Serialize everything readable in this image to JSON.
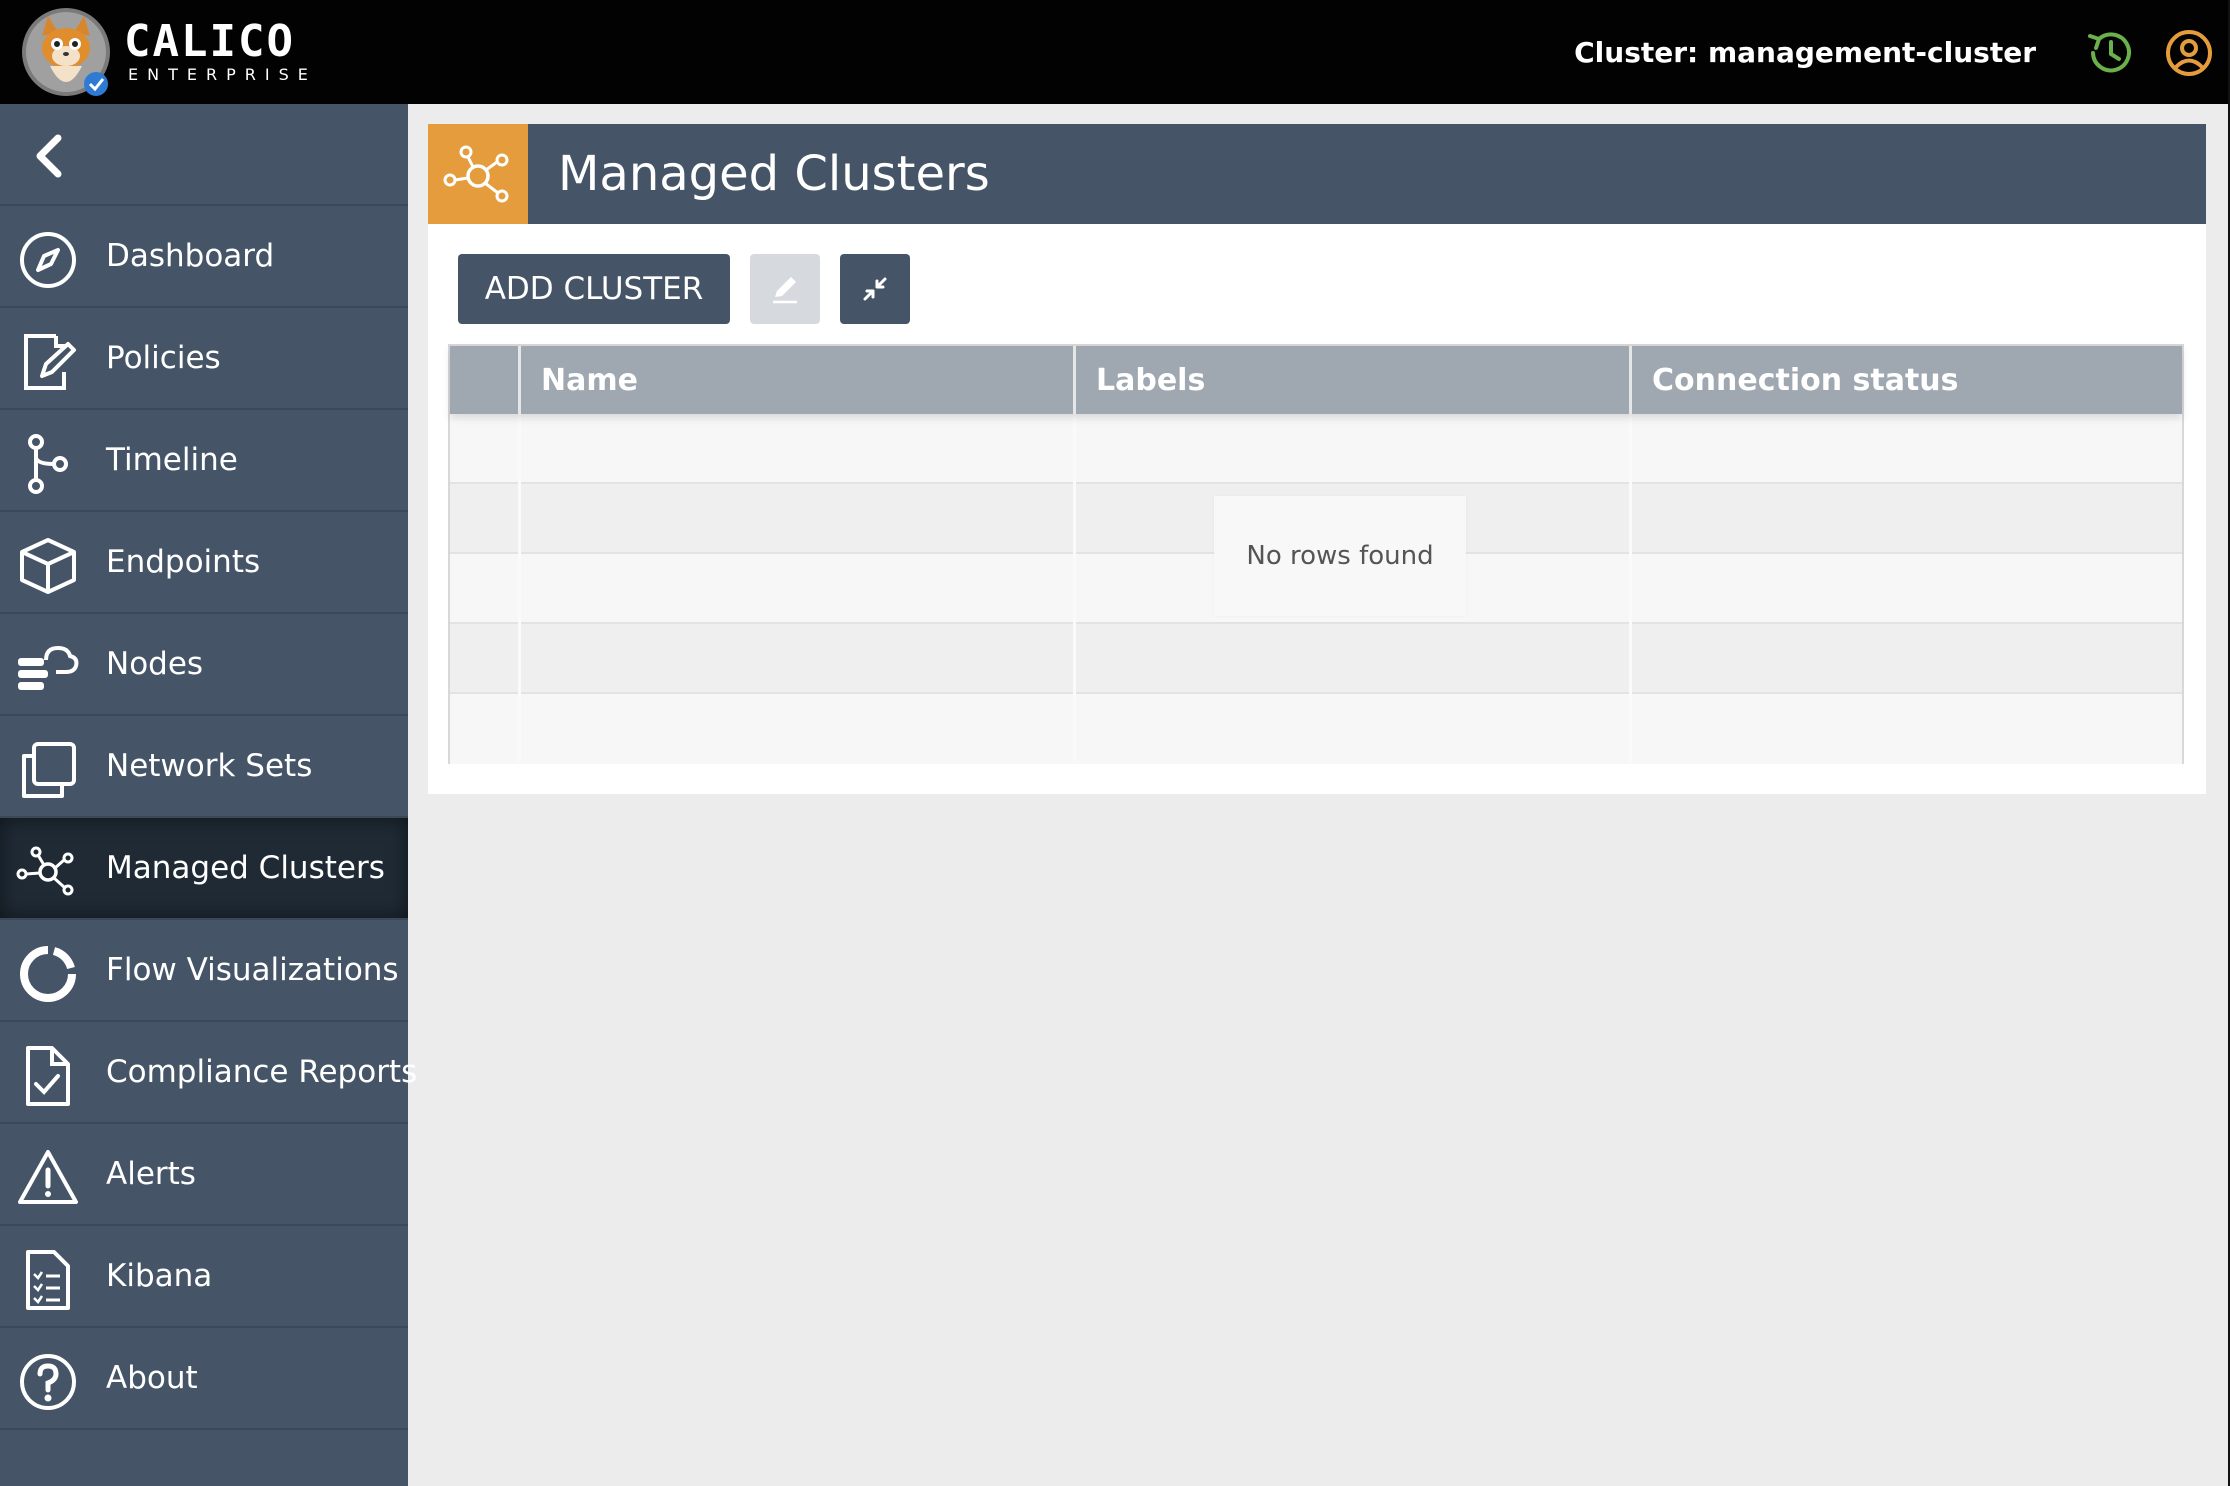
{
  "header": {
    "brand_name": "CALICO",
    "brand_sub": "ENTERPRISE",
    "cluster_label": "Cluster: management-cluster",
    "icons": [
      "calico-cat-logo",
      "history-icon",
      "user-icon"
    ],
    "colors": {
      "background": "#020202",
      "history": "#6ab04c",
      "user": "#e59c3c"
    }
  },
  "sidebar": {
    "collapse_icon": "chevron-left-icon",
    "items": [
      {
        "label": "Dashboard",
        "icon": "compass-icon"
      },
      {
        "label": "Policies",
        "icon": "document-edit-icon"
      },
      {
        "label": "Timeline",
        "icon": "branch-icon"
      },
      {
        "label": "Endpoints",
        "icon": "cube-icon"
      },
      {
        "label": "Nodes",
        "icon": "cloud-server-icon"
      },
      {
        "label": "Network Sets",
        "icon": "copy-icon"
      },
      {
        "label": "Managed Clusters",
        "icon": "cluster-network-icon",
        "active": true
      },
      {
        "label": "Flow Visualizations",
        "icon": "donut-icon"
      },
      {
        "label": "Compliance Reports",
        "icon": "document-check-icon"
      },
      {
        "label": "Alerts",
        "icon": "warning-triangle-icon"
      },
      {
        "label": "Kibana",
        "icon": "checklist-icon"
      },
      {
        "label": "About",
        "icon": "question-circle-icon"
      }
    ],
    "colors": {
      "background": "#455567",
      "active": "#1f2a35"
    }
  },
  "main": {
    "title": "Managed Clusters",
    "title_icon": "cluster-network-icon",
    "accent": "#e59c3c",
    "toolbar": {
      "add_label": "ADD CLUSTER",
      "edit_icon": "pencil-icon",
      "compress_icon": "compress-icon"
    },
    "table": {
      "columns": [
        "",
        "Name",
        "Labels",
        "Connection status"
      ],
      "empty_message": "No rows found"
    }
  }
}
